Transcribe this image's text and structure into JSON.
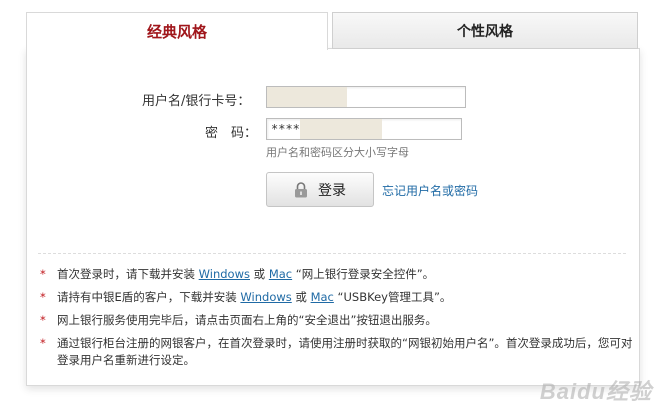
{
  "tabs": {
    "classic": "经典风格",
    "personal": "个性风格"
  },
  "form": {
    "username_label": "用户名/银行卡号：",
    "password_label": "密　码：",
    "password_value": "****",
    "hint": "用户名和密码区分大小写字母",
    "login_label": "登录",
    "forgot_label": "忘记用户名或密码"
  },
  "notes": {
    "star": "*",
    "n1_a": "首次登录时，请下载并安装",
    "n1_windows": "Windows",
    "n1_or": "或",
    "n1_mac": "Mac",
    "n1_b": "“网上银行登录安全控件”。",
    "n2_a": "请持有中银E盾的客户，下载并安装",
    "n2_windows": "Windows",
    "n2_or": "或",
    "n2_mac": "Mac",
    "n2_b": "“USBKey管理工具”。",
    "n3": "网上银行服务使用完毕后，请点击页面右上角的“安全退出”按钮退出服务。",
    "n4": "通过银行柜台注册的网银客户，在首次登录时，请使用注册时获取的“网银初始用户名”。首次登录成功后，您可对登录用户名重新进行设定。"
  },
  "watermark": "Baidu经验",
  "colors": {
    "brand_red": "#a0161b",
    "link_blue": "#1f6aa5",
    "star_red": "#c0161b"
  },
  "icons": {
    "login": "lock-icon"
  }
}
